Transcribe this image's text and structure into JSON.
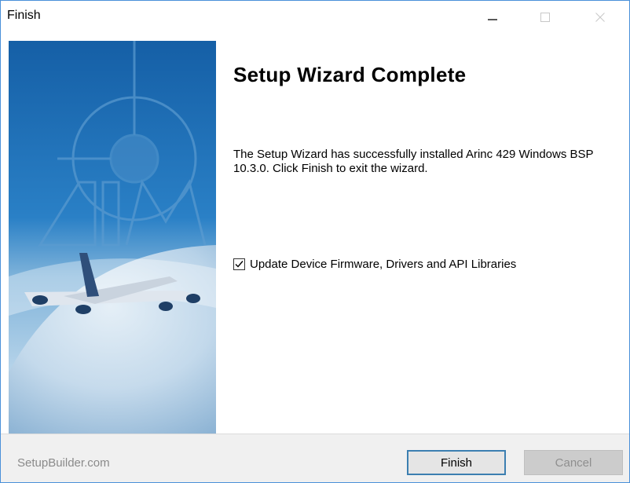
{
  "window": {
    "title": "Finish",
    "controls": {
      "minimize": "minimize-icon",
      "maximize": "maximize-icon",
      "close": "close-icon"
    }
  },
  "sidebar": {
    "image": "airplane-over-earth-banner"
  },
  "main": {
    "heading": "Setup Wizard Complete",
    "description": "The Setup Wizard has successfully installed Arinc 429 Windows BSP 10.3.0. Click Finish to exit the wizard.",
    "checkbox": {
      "label": "Update Device Firmware, Drivers and API Libraries",
      "checked": true
    }
  },
  "footer": {
    "brand": "SetupBuilder.com",
    "finish_label": "Finish",
    "cancel_label": "Cancel"
  },
  "colors": {
    "window_border": "#4a90d9",
    "finish_border": "#3c7fb1",
    "footer_bg": "#f0f0f0",
    "disabled_text": "#8f8f8f"
  }
}
